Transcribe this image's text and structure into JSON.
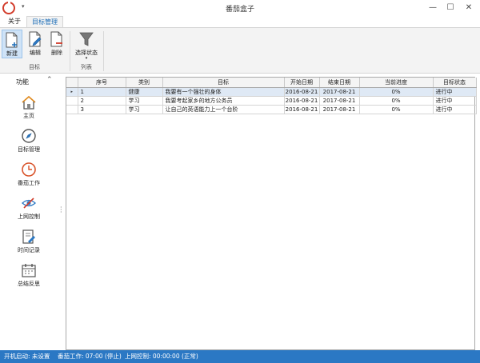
{
  "window": {
    "title": "番茄盒子",
    "qa_arrow": "▾",
    "minimize": "—",
    "maximize": "☐",
    "close": "✕"
  },
  "ribbon_tabs": [
    {
      "label": "关于",
      "active": false
    },
    {
      "label": "目标管理",
      "active": true
    }
  ],
  "ribbon": {
    "groups": [
      {
        "label": "目标",
        "buttons": [
          {
            "label": "新建",
            "icon": "new-document-icon",
            "selected": true
          },
          {
            "label": "编辑",
            "icon": "edit-document-icon",
            "selected": false
          },
          {
            "label": "删除",
            "icon": "delete-document-icon",
            "selected": false
          }
        ]
      },
      {
        "label": "列表",
        "buttons": [
          {
            "label": "选择状态",
            "icon": "filter-icon",
            "selected": false,
            "dropdown": "▾"
          }
        ]
      }
    ]
  },
  "sidebar": {
    "header": "功能",
    "collapse_glyph": "⌃",
    "items": [
      {
        "label": "主页",
        "icon": "home-icon"
      },
      {
        "label": "目标管理",
        "icon": "compass-icon"
      },
      {
        "label": "番茄工作",
        "icon": "clock-icon"
      },
      {
        "label": "上网控制",
        "icon": "eye-blocked-icon"
      },
      {
        "label": "时间记录",
        "icon": "time-record-icon"
      },
      {
        "label": "总结反思",
        "icon": "calendar-icon"
      }
    ]
  },
  "grid": {
    "columns": [
      "",
      "序号",
      "类别",
      "目标",
      "开始日期",
      "结束日期",
      "当前进度",
      "目标状态"
    ],
    "rows": [
      {
        "indicator": "▸",
        "no": "1",
        "category": "健康",
        "goal": "我要有一个强壮的身体",
        "start": "2016-08-21",
        "end": "2017-08-21",
        "progress": "0%",
        "status": "进行中",
        "current": true
      },
      {
        "indicator": "",
        "no": "2",
        "category": "学习",
        "goal": "我要考起家乡的地方公务员",
        "start": "2016-08-21",
        "end": "2017-08-21",
        "progress": "0%",
        "status": "进行中",
        "current": false
      },
      {
        "indicator": "",
        "no": "3",
        "category": "学习",
        "goal": "让自己的英语能力上一个台阶",
        "start": "2016-08-21",
        "end": "2017-08-21",
        "progress": "0%",
        "status": "进行中",
        "current": false
      }
    ]
  },
  "statusbar": {
    "startup": "开机启动: 未设置",
    "tomato": "番茄工作: 07:00 (停止)",
    "internet": "上网控制: 00:00:00 (正常)"
  },
  "colors": {
    "accent": "#1f6fb8",
    "statusbar": "#2b78c4",
    "app_icon": "#d23b2a",
    "selected_row": "#dfe9f5"
  }
}
